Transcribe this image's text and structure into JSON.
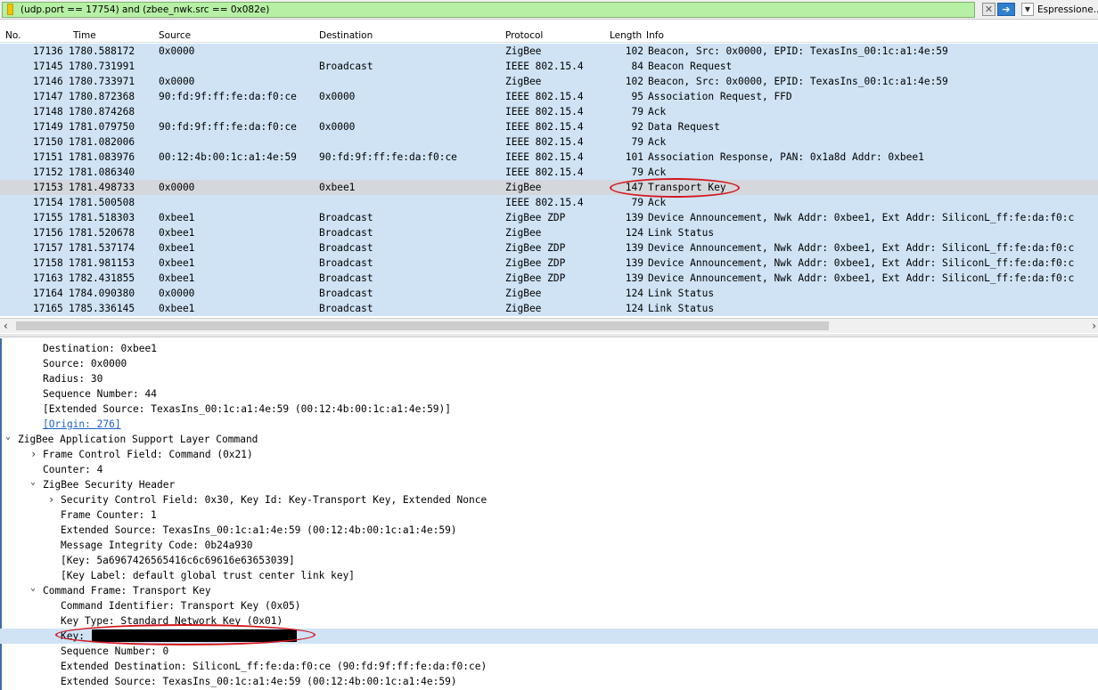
{
  "filter": {
    "expression": "(udp.port == 17754) and (zbee_nwk.src == 0x082e)",
    "expression_button": "Espressione...",
    "clear_icon": "clear-icon",
    "apply_icon": "arrow-right-icon",
    "dropdown_icon": "chevron-down-icon"
  },
  "columns": {
    "no": "No.",
    "time": "Time",
    "source": "Source",
    "destination": "Destination",
    "protocol": "Protocol",
    "length": "Length",
    "info": "Info"
  },
  "packets": [
    {
      "no": "17136",
      "time": "1780.588172",
      "source": "0x0000",
      "destination": "",
      "protocol": "ZigBee",
      "length": "102",
      "info": "Beacon, Src: 0x0000, EPID: TexasIns_00:1c:a1:4e:59"
    },
    {
      "no": "17145",
      "time": "1780.731991",
      "source": "",
      "destination": "Broadcast",
      "protocol": "IEEE 802.15.4",
      "length": "84",
      "info": "Beacon Request"
    },
    {
      "no": "17146",
      "time": "1780.733971",
      "source": "0x0000",
      "destination": "",
      "protocol": "ZigBee",
      "length": "102",
      "info": "Beacon, Src: 0x0000, EPID: TexasIns_00:1c:a1:4e:59"
    },
    {
      "no": "17147",
      "time": "1780.872368",
      "source": "90:fd:9f:ff:fe:da:f0:ce",
      "destination": "0x0000",
      "protocol": "IEEE 802.15.4",
      "length": "95",
      "info": "Association Request, FFD"
    },
    {
      "no": "17148",
      "time": "1780.874268",
      "source": "",
      "destination": "",
      "protocol": "IEEE 802.15.4",
      "length": "79",
      "info": "Ack"
    },
    {
      "no": "17149",
      "time": "1781.079750",
      "source": "90:fd:9f:ff:fe:da:f0:ce",
      "destination": "0x0000",
      "protocol": "IEEE 802.15.4",
      "length": "92",
      "info": "Data Request"
    },
    {
      "no": "17150",
      "time": "1781.082006",
      "source": "",
      "destination": "",
      "protocol": "IEEE 802.15.4",
      "length": "79",
      "info": "Ack"
    },
    {
      "no": "17151",
      "time": "1781.083976",
      "source": "00:12:4b:00:1c:a1:4e:59",
      "destination": "90:fd:9f:ff:fe:da:f0:ce",
      "protocol": "IEEE 802.15.4",
      "length": "101",
      "info": "Association Response, PAN: 0x1a8d Addr: 0xbee1"
    },
    {
      "no": "17152",
      "time": "1781.086340",
      "source": "",
      "destination": "",
      "protocol": "IEEE 802.15.4",
      "length": "79",
      "info": "Ack"
    },
    {
      "no": "17153",
      "time": "1781.498733",
      "source": "0x0000",
      "destination": "0xbee1",
      "protocol": "ZigBee",
      "length": "147",
      "info": "Transport Key"
    },
    {
      "no": "17154",
      "time": "1781.500508",
      "source": "",
      "destination": "",
      "protocol": "IEEE 802.15.4",
      "length": "79",
      "info": "Ack"
    },
    {
      "no": "17155",
      "time": "1781.518303",
      "source": "0xbee1",
      "destination": "Broadcast",
      "protocol": "ZigBee ZDP",
      "length": "139",
      "info": "Device Announcement, Nwk Addr: 0xbee1, Ext Addr: SiliconL_ff:fe:da:f0:c"
    },
    {
      "no": "17156",
      "time": "1781.520678",
      "source": "0xbee1",
      "destination": "Broadcast",
      "protocol": "ZigBee",
      "length": "124",
      "info": "Link Status"
    },
    {
      "no": "17157",
      "time": "1781.537174",
      "source": "0xbee1",
      "destination": "Broadcast",
      "protocol": "ZigBee ZDP",
      "length": "139",
      "info": "Device Announcement, Nwk Addr: 0xbee1, Ext Addr: SiliconL_ff:fe:da:f0:c"
    },
    {
      "no": "17158",
      "time": "1781.981153",
      "source": "0xbee1",
      "destination": "Broadcast",
      "protocol": "ZigBee ZDP",
      "length": "139",
      "info": "Device Announcement, Nwk Addr: 0xbee1, Ext Addr: SiliconL_ff:fe:da:f0:c"
    },
    {
      "no": "17163",
      "time": "1782.431855",
      "source": "0xbee1",
      "destination": "Broadcast",
      "protocol": "ZigBee ZDP",
      "length": "139",
      "info": "Device Announcement, Nwk Addr: 0xbee1, Ext Addr: SiliconL_ff:fe:da:f0:c"
    },
    {
      "no": "17164",
      "time": "1784.090380",
      "source": "0x0000",
      "destination": "Broadcast",
      "protocol": "ZigBee",
      "length": "124",
      "info": "Link Status"
    },
    {
      "no": "17165",
      "time": "1785.336145",
      "source": "0xbee1",
      "destination": "Broadcast",
      "protocol": "ZigBee",
      "length": "124",
      "info": "Link Status"
    }
  ],
  "selected_packet_no": "17153",
  "details": [
    {
      "indent": 1,
      "twisty": "",
      "text": "Destination: 0xbee1"
    },
    {
      "indent": 1,
      "twisty": "",
      "text": "Source: 0x0000"
    },
    {
      "indent": 1,
      "twisty": "",
      "text": "Radius: 30"
    },
    {
      "indent": 1,
      "twisty": "",
      "text": "Sequence Number: 44"
    },
    {
      "indent": 1,
      "twisty": "",
      "text": "[Extended Source: TexasIns_00:1c:a1:4e:59 (00:12:4b:00:1c:a1:4e:59)]"
    },
    {
      "indent": 1,
      "twisty": "",
      "text": "[Origin: 276]",
      "link": true
    },
    {
      "indent": 0,
      "twisty": "expanded",
      "text": "ZigBee Application Support Layer Command"
    },
    {
      "indent": 1,
      "twisty": "collapsed",
      "text": "Frame Control Field: Command (0x21)"
    },
    {
      "indent": 1,
      "twisty": "",
      "text": "Counter: 4"
    },
    {
      "indent": 1,
      "twisty": "expanded",
      "text": "ZigBee Security Header"
    },
    {
      "indent": 2,
      "twisty": "collapsed",
      "text": "Security Control Field: 0x30, Key Id: Key-Transport Key, Extended Nonce"
    },
    {
      "indent": 2,
      "twisty": "",
      "text": "Frame Counter: 1"
    },
    {
      "indent": 2,
      "twisty": "",
      "text": "Extended Source: TexasIns_00:1c:a1:4e:59 (00:12:4b:00:1c:a1:4e:59)"
    },
    {
      "indent": 2,
      "twisty": "",
      "text": "Message Integrity Code: 0b24a930"
    },
    {
      "indent": 2,
      "twisty": "",
      "text": "[Key: 5a6967426565416c6c69616e63653039]"
    },
    {
      "indent": 2,
      "twisty": "",
      "text": "[Key Label: default global trust center link key]"
    },
    {
      "indent": 1,
      "twisty": "expanded",
      "text": "Command Frame: Transport Key"
    },
    {
      "indent": 2,
      "twisty": "",
      "text": "Command Identifier: Transport Key (0x05)"
    },
    {
      "indent": 2,
      "twisty": "",
      "text": "Key Type: Standard Network Key (0x01)"
    },
    {
      "indent": 2,
      "twisty": "",
      "text": "Key:",
      "redacted": true,
      "highlight": true
    },
    {
      "indent": 2,
      "twisty": "",
      "text": "Sequence Number: 0"
    },
    {
      "indent": 2,
      "twisty": "",
      "text": "Extended Destination: SiliconL_ff:fe:da:f0:ce (90:fd:9f:ff:fe:da:f0:ce)"
    },
    {
      "indent": 2,
      "twisty": "",
      "text": "Extended Source: TexasIns_00:1c:a1:4e:59 (00:12:4b:00:1c:a1:4e:59)"
    }
  ],
  "scroll_icons": {
    "left": "chevron-left-icon",
    "right": "chevron-right-icon"
  },
  "colors": {
    "filter_valid": "#b6f0a4",
    "row_bg": "#cfe3f5",
    "selected_row_bg": "#d4d8dd",
    "annotation_red": "#d4161d",
    "link": "#1a5fcf"
  }
}
